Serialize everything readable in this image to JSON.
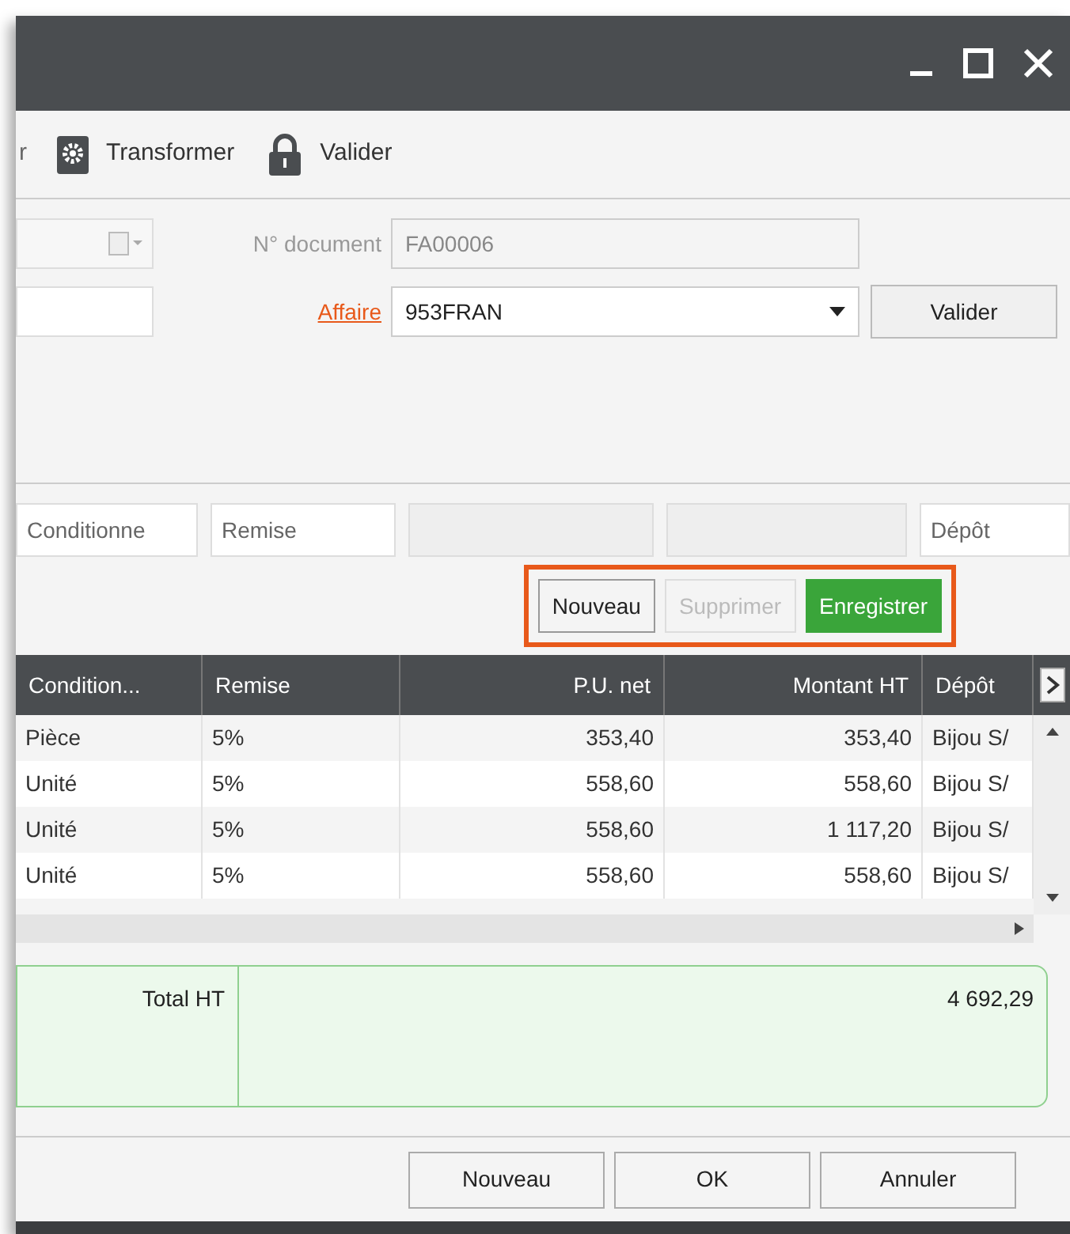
{
  "toolbar": {
    "items": [
      {
        "kind": "cut",
        "label": "r"
      },
      {
        "kind": "gear",
        "label": "Transformer"
      },
      {
        "kind": "lock",
        "label": "Valider"
      }
    ]
  },
  "form": {
    "document_number": {
      "label": "N° document",
      "value": "FA00006",
      "disabled": true
    },
    "affaire": {
      "label": "Affaire",
      "value": "953FRAN"
    },
    "validate_button": "Valider"
  },
  "filters": [
    {
      "kind": "text",
      "value": "Conditionne"
    },
    {
      "kind": "text",
      "value": "Remise"
    },
    {
      "kind": "blank"
    },
    {
      "kind": "blank"
    },
    {
      "kind": "text",
      "value": "Dépôt"
    }
  ],
  "line_actions": [
    {
      "label": "Nouveau",
      "kind": "default",
      "disabled": false
    },
    {
      "label": "Supprimer",
      "kind": "default",
      "disabled": true
    },
    {
      "label": "Enregistrer",
      "kind": "primary",
      "disabled": false
    }
  ],
  "table": {
    "columns": [
      "Condition...",
      "Remise",
      "P.U. net",
      "Montant HT",
      "Dépôt"
    ],
    "rows": [
      [
        "Pièce",
        "5%",
        "353,40",
        "353,40",
        "Bijou S/"
      ],
      [
        "Unité",
        "5%",
        "558,60",
        "558,60",
        "Bijou S/"
      ],
      [
        "Unité",
        "5%",
        "558,60",
        "1 117,20",
        "Bijou S/"
      ],
      [
        "Unité",
        "5%",
        "558,60",
        "558,60",
        "Bijou S/"
      ]
    ]
  },
  "totals": {
    "label": "Total HT",
    "value": "4 692,29"
  },
  "footer_buttons": [
    "Nouveau",
    "OK",
    "Annuler"
  ]
}
